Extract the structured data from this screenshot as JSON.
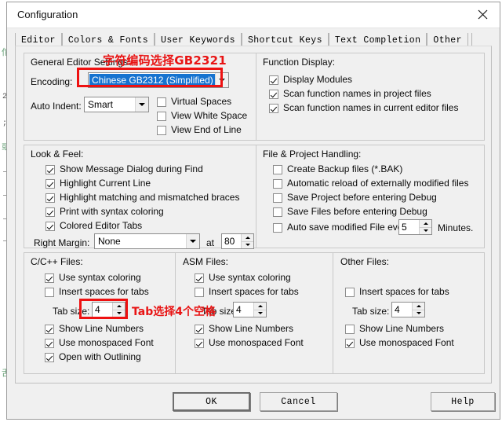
{
  "background": {
    "gutter_marks": [
      "佗",
      "2",
      ";",
      "或",
      "",
      "",
      "",
      ""
    ]
  },
  "window": {
    "title": "Configuration",
    "close_icon": "close-icon"
  },
  "tabs": [
    {
      "label": "Editor",
      "selected": true
    },
    {
      "label": "Colors & Fonts",
      "selected": false
    },
    {
      "label": "User Keywords",
      "selected": false
    },
    {
      "label": "Shortcut Keys",
      "selected": false
    },
    {
      "label": "Text Completion",
      "selected": false
    },
    {
      "label": "Other",
      "selected": false
    }
  ],
  "general": {
    "title": "General Editor Settings:",
    "encoding_label": "Encoding:",
    "encoding_value": "Chinese GB2312 (Simplified)",
    "auto_indent_label": "Auto Indent:",
    "auto_indent_value": "Smart",
    "checks": [
      {
        "label": "Virtual Spaces",
        "checked": false
      },
      {
        "label": "View White Space",
        "checked": false
      },
      {
        "label": "View End of Line",
        "checked": false
      }
    ]
  },
  "function_display": {
    "title": "Function Display:",
    "checks": [
      {
        "label": "Display Modules",
        "checked": true
      },
      {
        "label": "Scan function names in project files",
        "checked": true
      },
      {
        "label": "Scan function names in current editor files",
        "checked": true
      }
    ]
  },
  "look_feel": {
    "title": "Look & Feel:",
    "checks": [
      {
        "label": "Show Message Dialog during Find",
        "checked": true
      },
      {
        "label": "Highlight Current Line",
        "checked": true
      },
      {
        "label": "Highlight matching and mismatched braces",
        "checked": true
      },
      {
        "label": "Print with syntax coloring",
        "checked": true
      },
      {
        "label": "Colored Editor Tabs",
        "checked": true
      }
    ],
    "right_margin_label": "Right Margin:",
    "right_margin_value": "None",
    "at_label": "at",
    "at_value": "80"
  },
  "file_project": {
    "title": "File & Project Handling:",
    "checks": [
      {
        "label": "Create Backup files (*.BAK)",
        "checked": false
      },
      {
        "label": "Automatic reload of externally modified files",
        "checked": false
      },
      {
        "label": "Save Project before entering Debug",
        "checked": false
      },
      {
        "label": "Save Files before entering Debug",
        "checked": false
      }
    ],
    "autosave_label": "Auto save modified File every",
    "autosave_value": "5",
    "autosave_suffix": "Minutes."
  },
  "c_files": {
    "title": "C/C++ Files:",
    "check_syntax": {
      "label": "Use syntax coloring",
      "checked": true
    },
    "check_spaces": {
      "label": "Insert spaces for tabs",
      "checked": false
    },
    "tab_size_label": "Tab size:",
    "tab_size_value": "4",
    "check_linenum": {
      "label": "Show Line Numbers",
      "checked": true
    },
    "check_mono": {
      "label": "Use monospaced Font",
      "checked": true
    },
    "check_outline": {
      "label": "Open with Outlining",
      "checked": true
    }
  },
  "asm_files": {
    "title": "ASM Files:",
    "check_syntax": {
      "label": "Use syntax coloring",
      "checked": true
    },
    "check_spaces": {
      "label": "Insert spaces for tabs",
      "checked": false
    },
    "tab_size_label": "Tab size:",
    "tab_size_value": "4",
    "check_linenum": {
      "label": "Show Line Numbers",
      "checked": true
    },
    "check_mono": {
      "label": "Use monospaced Font",
      "checked": true
    }
  },
  "other_files": {
    "title": "Other Files:",
    "check_spaces": {
      "label": "Insert spaces for tabs",
      "checked": false
    },
    "tab_size_label": "Tab size:",
    "tab_size_value": "4",
    "check_linenum": {
      "label": "Show Line Numbers",
      "checked": false
    },
    "check_mono": {
      "label": "Use monospaced Font",
      "checked": true
    }
  },
  "buttons": {
    "ok": "OK",
    "cancel": "Cancel",
    "help": "Help"
  },
  "annotations": {
    "encoding_note": "字符编码选择GB2321",
    "tab_note": "Tab选择4个空格",
    "color": "#e81414"
  }
}
